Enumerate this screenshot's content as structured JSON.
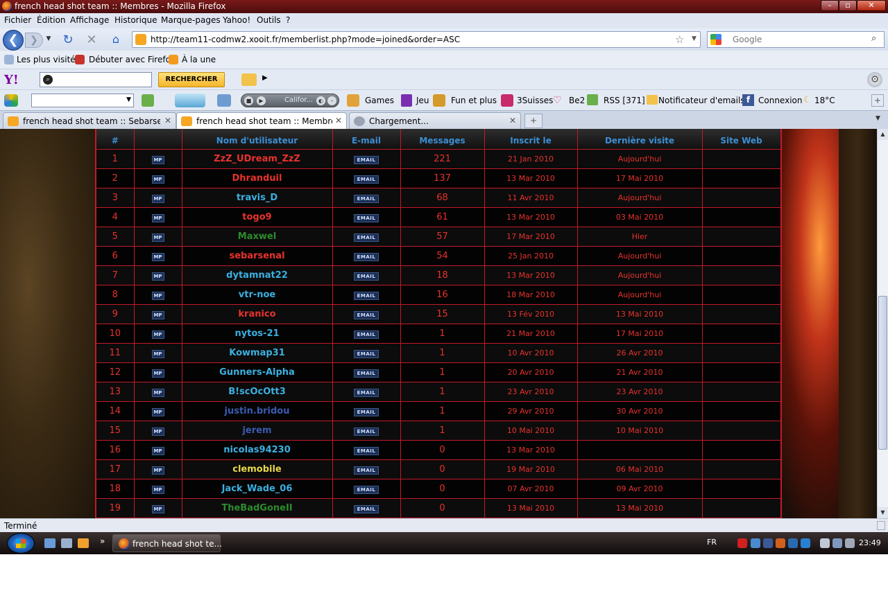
{
  "window": {
    "title": "french head shot team :: Membres - Mozilla Firefox"
  },
  "menu": [
    "Fichier",
    "Édition",
    "Affichage",
    "Historique",
    "Marque-pages",
    "Yahoo!",
    "Outils",
    "?"
  ],
  "nav": {
    "url": "http://team11-codmw2.xooit.fr/memberlist.php?mode=joined&order=ASC",
    "search_placeholder": "Google"
  },
  "bookmarks": [
    "Les plus visités",
    "Débuter avec Firefox",
    "À la une"
  ],
  "yahoo": {
    "button": "RECHERCHER"
  },
  "toolbar": {
    "player_text": "Califor...",
    "items": [
      "Games",
      "Jeu",
      "Fun et plus",
      "3Suisses",
      "Be2",
      "RSS [371]",
      "Notificateur d'emails",
      "Connexion",
      "18°C"
    ]
  },
  "tabs": [
    {
      "label": "french head shot team :: Sebarsenal",
      "active": false
    },
    {
      "label": "french head shot team :: Membres",
      "active": true
    },
    {
      "label": "Chargement...",
      "active": false
    }
  ],
  "table": {
    "headers": [
      "#",
      "",
      "Nom d'utilisateur",
      "E-mail",
      "Messages",
      "Inscrit le",
      "Dernière visite",
      "Site Web"
    ],
    "pm_label": "MP",
    "email_label": "EMAIL",
    "rows": [
      {
        "n": "1",
        "user": "ZzZ_UDream_ZzZ",
        "color": "#e8322c",
        "msgs": "221",
        "joined": "21 Jan 2010",
        "last": "Aujourd'hui"
      },
      {
        "n": "2",
        "user": "Dhranduil",
        "color": "#e8322c",
        "msgs": "137",
        "joined": "13 Mar 2010",
        "last": "17 Mai 2010"
      },
      {
        "n": "3",
        "user": "travis_D",
        "color": "#3bb0e0",
        "msgs": "68",
        "joined": "11 Avr 2010",
        "last": "Aujourd'hui"
      },
      {
        "n": "4",
        "user": "togo9",
        "color": "#e8322c",
        "msgs": "61",
        "joined": "13 Mar 2010",
        "last": "03 Mai 2010"
      },
      {
        "n": "5",
        "user": "Maxwel",
        "color": "#2e8b2e",
        "msgs": "57",
        "joined": "17 Mar 2010",
        "last": "Hier"
      },
      {
        "n": "6",
        "user": "sebarsenal",
        "color": "#e8322c",
        "msgs": "54",
        "joined": "25 Jan 2010",
        "last": "Aujourd'hui"
      },
      {
        "n": "7",
        "user": "dytamnat22",
        "color": "#3bb0e0",
        "msgs": "18",
        "joined": "13 Mar 2010",
        "last": "Aujourd'hui"
      },
      {
        "n": "8",
        "user": "vtr-noe",
        "color": "#3bb0e0",
        "msgs": "16",
        "joined": "18 Mar 2010",
        "last": "Aujourd'hui"
      },
      {
        "n": "9",
        "user": "kranico",
        "color": "#e8322c",
        "msgs": "15",
        "joined": "13 Fév 2010",
        "last": "13 Mai 2010"
      },
      {
        "n": "10",
        "user": "nytos-21",
        "color": "#3bb0e0",
        "msgs": "1",
        "joined": "21 Mar 2010",
        "last": "17 Mai 2010"
      },
      {
        "n": "11",
        "user": "Kowmap31",
        "color": "#3bb0e0",
        "msgs": "1",
        "joined": "10 Avr 2010",
        "last": "26 Avr 2010"
      },
      {
        "n": "12",
        "user": "Gunners-Alpha",
        "color": "#3bb0e0",
        "msgs": "1",
        "joined": "20 Avr 2010",
        "last": "21 Avr 2010"
      },
      {
        "n": "13",
        "user": "B!scOcOtt3",
        "color": "#3bb0e0",
        "msgs": "1",
        "joined": "23 Avr 2010",
        "last": "23 Avr 2010"
      },
      {
        "n": "14",
        "user": "justin.bridou",
        "color": "#3a5bb0",
        "msgs": "1",
        "joined": "29 Avr 2010",
        "last": "30 Avr 2010"
      },
      {
        "n": "15",
        "user": "jerem",
        "color": "#3a5bb0",
        "msgs": "1",
        "joined": "10 Mai 2010",
        "last": "10 Mai 2010"
      },
      {
        "n": "16",
        "user": "nicolas94230",
        "color": "#3bb0e0",
        "msgs": "0",
        "joined": "13 Mar 2010",
        "last": ""
      },
      {
        "n": "17",
        "user": "clemobile",
        "color": "#e8d84a",
        "msgs": "0",
        "joined": "19 Mar 2010",
        "last": "06 Mai 2010"
      },
      {
        "n": "18",
        "user": "Jack_Wade_06",
        "color": "#3bb0e0",
        "msgs": "0",
        "joined": "07 Avr 2010",
        "last": "09 Avr 2010"
      },
      {
        "n": "19",
        "user": "TheBadGoneII",
        "color": "#2e8b2e",
        "msgs": "0",
        "joined": "13 Mai 2010",
        "last": "13 Mai 2010"
      }
    ]
  },
  "status": "Terminé",
  "taskbar": {
    "task": "french head shot te...",
    "lang": "FR",
    "clock": "23:49"
  }
}
